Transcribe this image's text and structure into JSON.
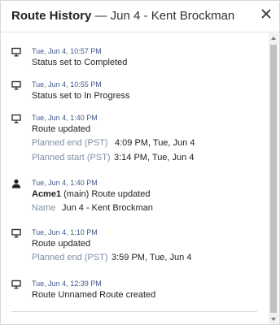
{
  "dialog": {
    "title": "Route History",
    "subtitle": " — Jun 4 - Kent Brockman"
  },
  "entries": [
    {
      "icon": "monitor-icon",
      "time": "Tue, Jun 4, 10:57 PM",
      "message": "Status set to Completed"
    },
    {
      "icon": "monitor-icon",
      "time": "Tue, Jun 4, 10:55 PM",
      "message": "Status set to In Progress"
    },
    {
      "icon": "monitor-icon",
      "time": "Tue, Jun 4, 1:40 PM",
      "message": "Route updated",
      "fields": [
        {
          "label": "Planned end (PST)",
          "value": "4:09 PM, Tue, Jun 4"
        },
        {
          "label": "Planned start (PST)",
          "value": "3:14 PM, Tue, Jun 4"
        }
      ]
    },
    {
      "icon": "user-icon",
      "time": "Tue, Jun 4, 1:40 PM",
      "actor": "Acme1",
      "message": " (main) Route updated",
      "fields": [
        {
          "label": "Name",
          "value": "Jun 4 - Kent Brockman"
        }
      ]
    },
    {
      "icon": "monitor-icon",
      "time": "Tue, Jun 4, 1:10 PM",
      "message": "Route updated",
      "fields": [
        {
          "label": "Planned end (PST)",
          "value": "3:59 PM, Tue, Jun 4"
        }
      ]
    },
    {
      "icon": "monitor-icon",
      "time": "Tue, Jun 4, 12:39 PM",
      "message": "Route Unnamed Route created"
    }
  ],
  "colors": {
    "timestamp": "#3f5a8a",
    "field_label": "#7f8ea6",
    "text": "#222222"
  }
}
